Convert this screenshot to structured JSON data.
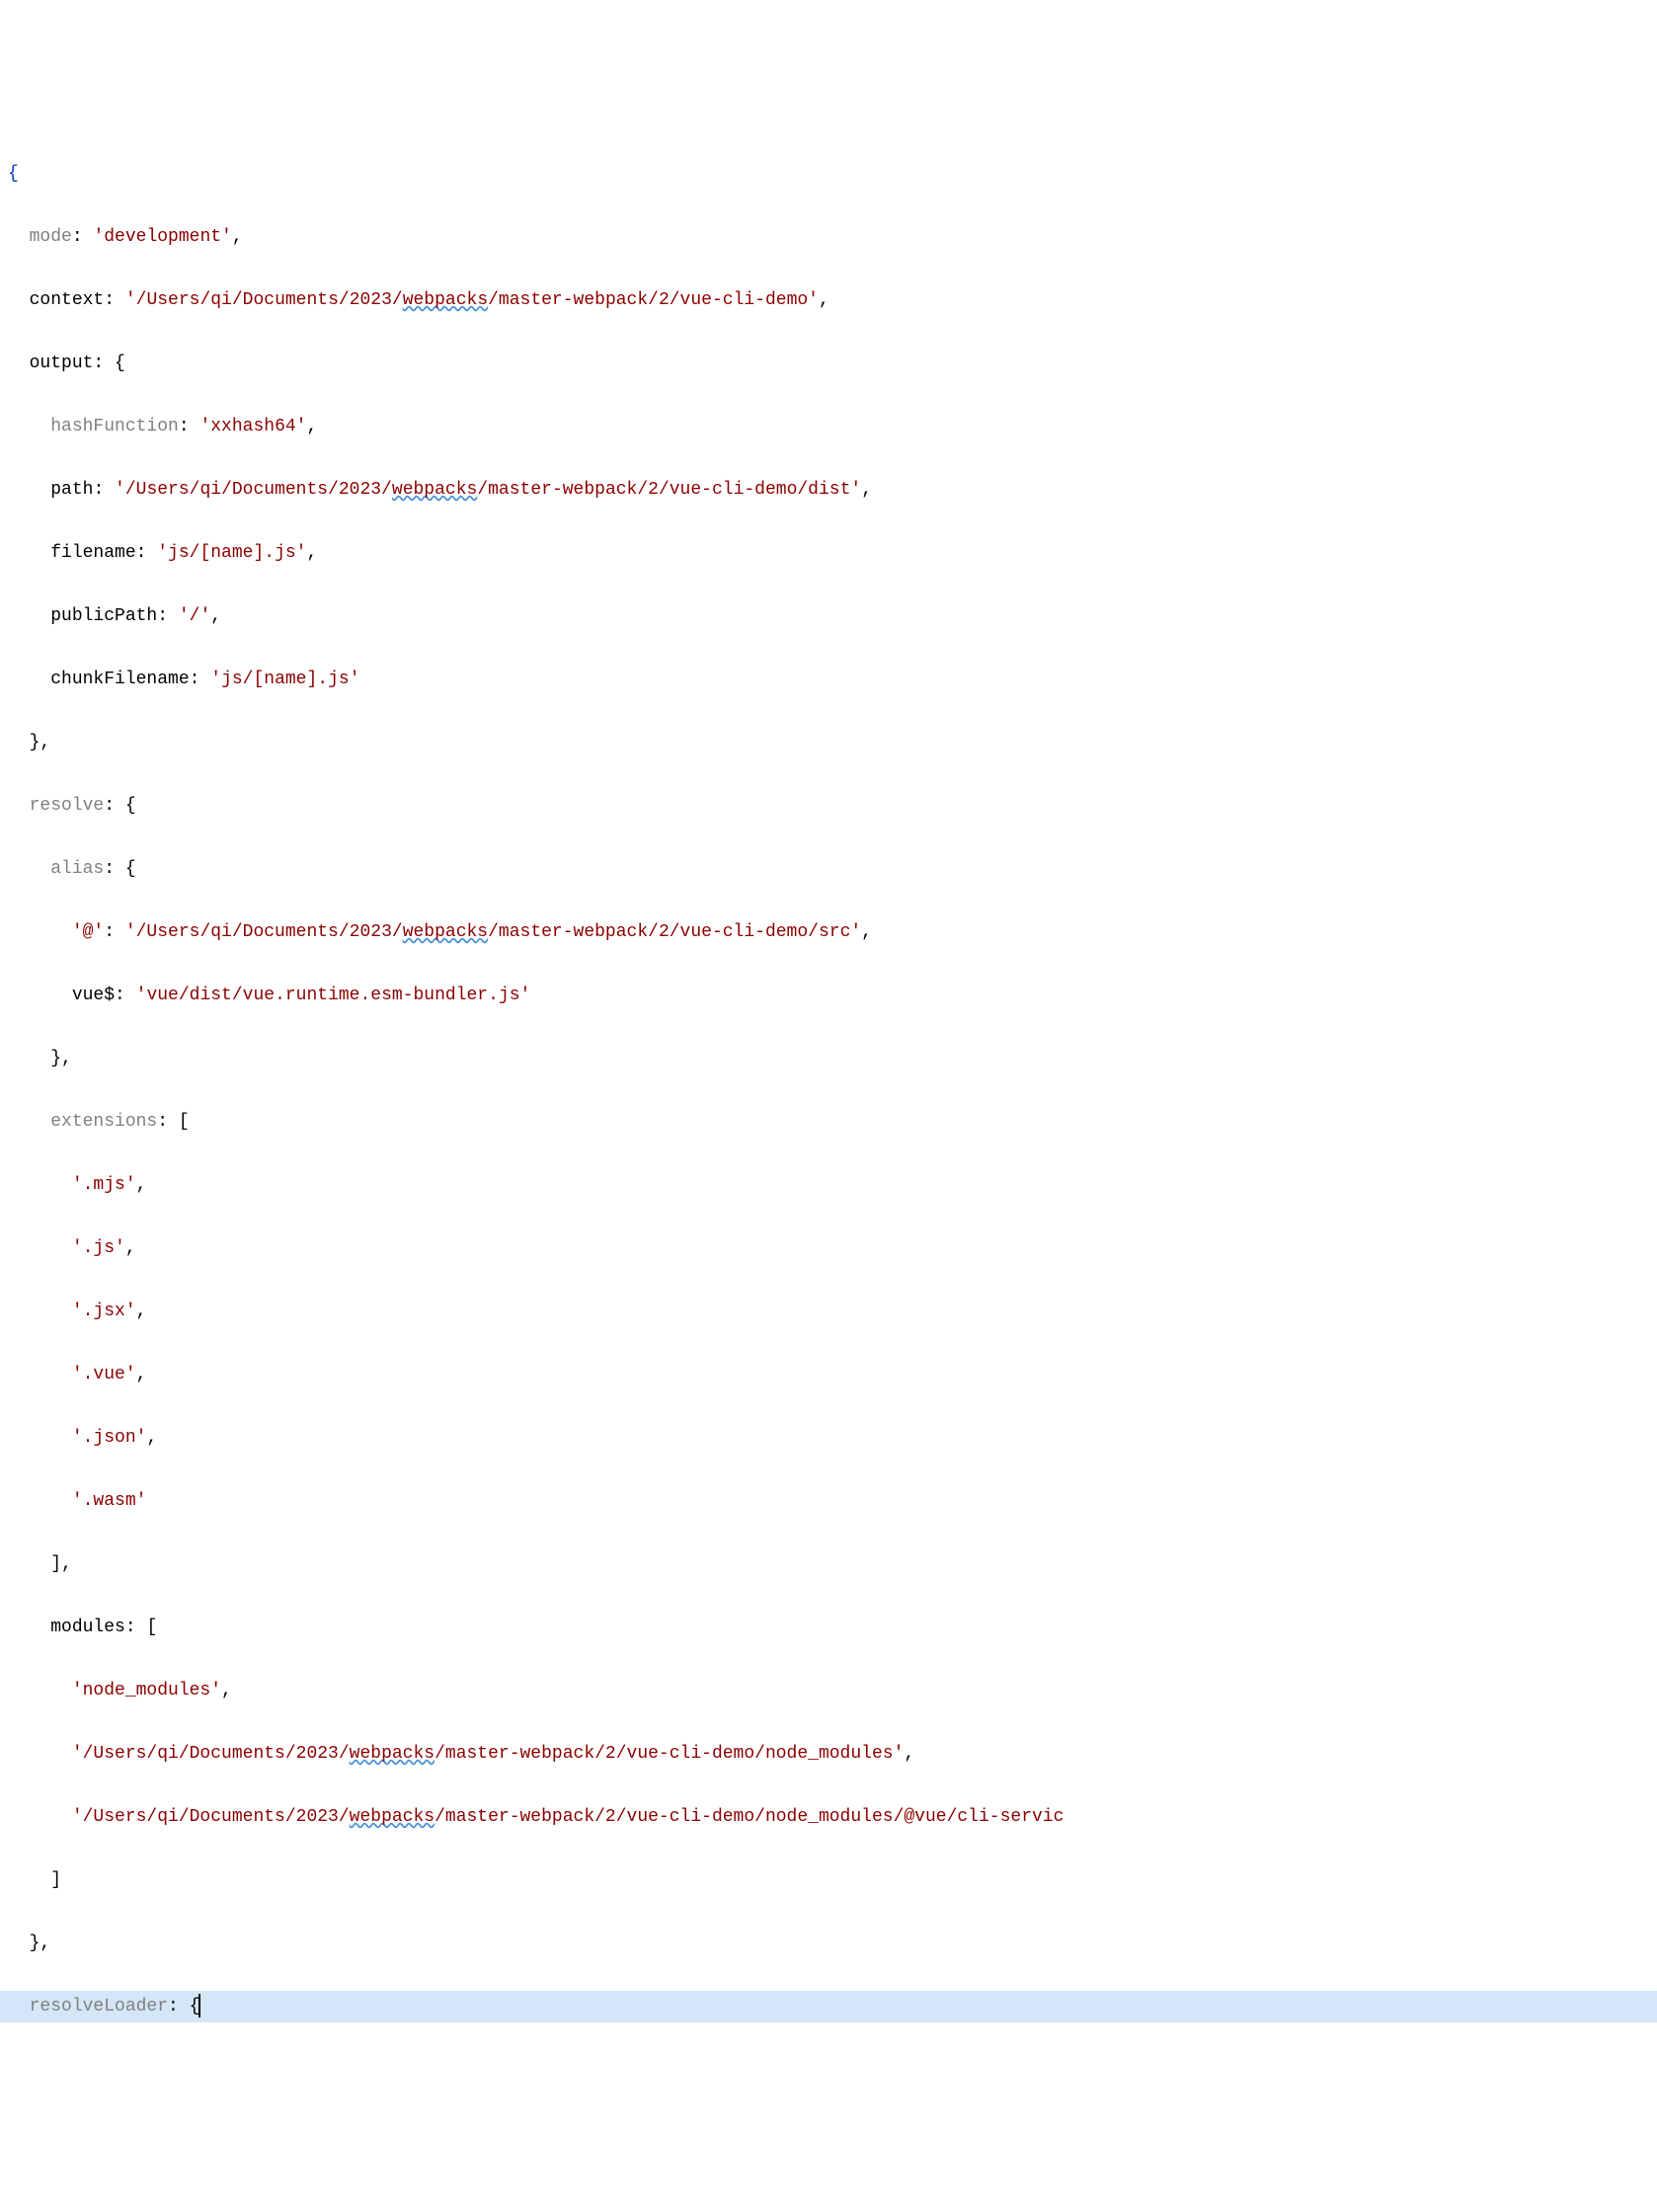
{
  "code": {
    "open_brace": "{",
    "mode_key": "mode",
    "mode_value": "'development'",
    "context_key": "context",
    "context_value_pre": "'/Users/qi/Documents/2023/",
    "context_value_webpacks": "webpacks",
    "context_value_post": "/master-webpack/2/vue-cli-demo'",
    "output_key": "output",
    "output_open": "{",
    "hashFunction_key": "hashFunction",
    "hashFunction_value": "'xxhash64'",
    "path_key": "path",
    "path_value_pre": "'/Users/qi/Documents/2023/",
    "path_value_webpacks": "webpacks",
    "path_value_post": "/master-webpack/2/vue-cli-demo/dist'",
    "filename_key": "filename",
    "filename_value": "'js/[name].js'",
    "publicPath_key": "publicPath",
    "publicPath_value": "'/'",
    "chunkFilename_key": "chunkFilename",
    "chunkFilename_value": "'js/[name].js'",
    "output_close": "}",
    "resolve_key": "resolve",
    "resolve_open": "{",
    "alias_key": "alias",
    "alias_open": "{",
    "at_key": "'@'",
    "at_value_pre": "'/Users/qi/Documents/2023/",
    "at_value_webpacks": "webpacks",
    "at_value_post": "/master-webpack/2/vue-cli-demo/src'",
    "vue_key": "vue$",
    "vue_value": "'vue/dist/vue.runtime.esm-bundler.js'",
    "alias_close": "}",
    "extensions_key": "extensions",
    "extensions_open": "[",
    "ext_mjs": "'.mjs'",
    "ext_js": "'.js'",
    "ext_jsx": "'.jsx'",
    "ext_vue": "'.vue'",
    "ext_json": "'.json'",
    "ext_wasm": "'.wasm'",
    "extensions_close": "]",
    "modules_key": "modules",
    "modules_open": "[",
    "mod_node": "'node_modules'",
    "mod_path1_pre": "'/Users/qi/Documents/2023/",
    "mod_path1_webpacks": "webpacks",
    "mod_path1_post": "/master-webpack/2/vue-cli-demo/node_modules'",
    "mod_path2_pre": "'/Users/qi/Documents/2023/",
    "mod_path2_webpacks": "webpacks",
    "mod_path2_post": "/master-webpack/2/vue-cli-demo/node_modules/@vue/cli-servic",
    "modules_close": "]",
    "resolve_close": "}",
    "resolveLoader_key": "resolveLoader",
    "resolveLoader_open": "{"
  }
}
